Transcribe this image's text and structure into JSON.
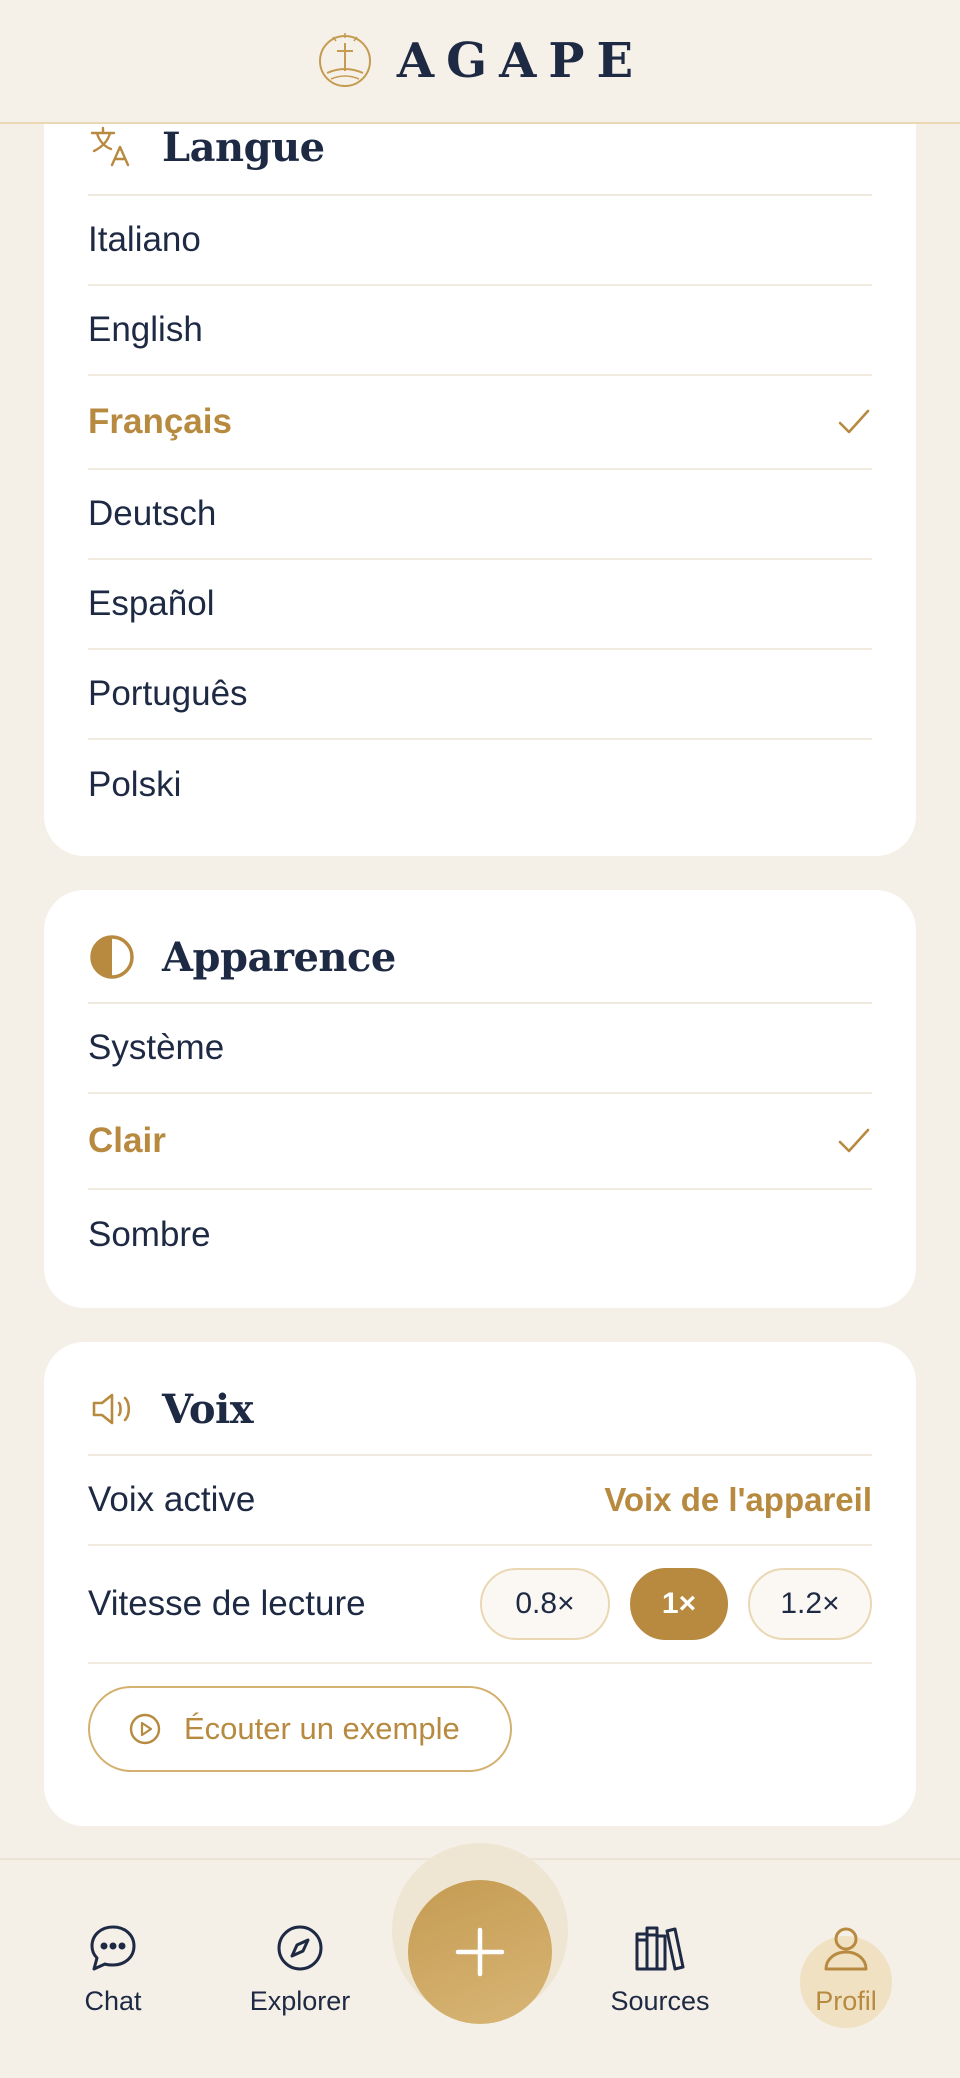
{
  "header": {
    "brand": "AGAPE",
    "logo_icon": "cross-in-circle-logo"
  },
  "language": {
    "title": "Langue",
    "icon": "translate-icon",
    "items": [
      {
        "label": "Italiano",
        "selected": false
      },
      {
        "label": "English",
        "selected": false
      },
      {
        "label": "Français",
        "selected": true
      },
      {
        "label": "Deutsch",
        "selected": false
      },
      {
        "label": "Español",
        "selected": false
      },
      {
        "label": "Português",
        "selected": false
      },
      {
        "label": "Polski",
        "selected": false
      }
    ]
  },
  "appearance": {
    "title": "Apparence",
    "icon": "contrast-icon",
    "items": [
      {
        "label": "Système",
        "selected": false
      },
      {
        "label": "Clair",
        "selected": true
      },
      {
        "label": "Sombre",
        "selected": false
      }
    ]
  },
  "voice": {
    "title": "Voix",
    "icon": "speaker-icon",
    "active_label": "Voix active",
    "active_value": "Voix de l'appareil",
    "speed_label": "Vitesse de lecture",
    "speeds": [
      {
        "label": "0.8×",
        "active": false
      },
      {
        "label": "1×",
        "active": true
      },
      {
        "label": "1.2×",
        "active": false
      }
    ],
    "listen_button": "Écouter un exemple"
  },
  "nav": {
    "items": [
      {
        "label": "Chat",
        "icon": "chat-bubble-icon",
        "active": false
      },
      {
        "label": "Explorer",
        "icon": "compass-icon",
        "active": false
      },
      {
        "label": "Sources",
        "icon": "books-icon",
        "active": false
      },
      {
        "label": "Profil",
        "icon": "user-icon",
        "active": true
      }
    ],
    "fab_icon": "plus-icon"
  },
  "colors": {
    "accent": "#b78a40",
    "text": "#1e2a44",
    "background": "#f4efe7"
  }
}
